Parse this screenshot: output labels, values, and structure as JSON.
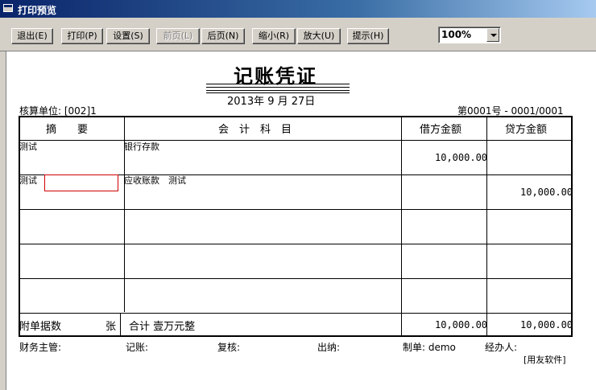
{
  "window": {
    "title": "打印预览"
  },
  "toolbar": {
    "exit": "退出(E)",
    "print": "打印(P)",
    "settings": "设置(S)",
    "prev": "前页(L)",
    "next": "后页(N)",
    "zoom_out": "缩小(R)",
    "zoom_in": "放大(U)",
    "hint": "提示(H)",
    "zoom_value": "100%"
  },
  "voucher": {
    "title": "记账凭证",
    "date": "2013年  9  月 27日",
    "unit": "核算单位: [002]1",
    "number": "第0001号 - 0001/0001",
    "headers": {
      "summary": "摘　　要",
      "account": "会　计　科　目",
      "debit": "借方金额",
      "credit": "贷方金额"
    },
    "rows": [
      {
        "summary": "测试",
        "account": "银行存款",
        "debit": "10,000.00",
        "credit": ""
      },
      {
        "summary": "测试",
        "account": "应收账款　测试",
        "debit": "",
        "credit": "10,000.00"
      }
    ],
    "footer": {
      "attach_label": "附单据数",
      "attach_unit": "张",
      "total_label": "合计 壹万元整",
      "debit_total": "10,000.00",
      "credit_total": "10,000.00"
    },
    "signatures": {
      "supervisor": "财务主管:",
      "bookkeeper": "记账:",
      "reviewer": "复核:",
      "cashier": "出纳:",
      "maker": "制单: demo",
      "handler": "经办人:"
    },
    "brand": "[用友软件]"
  }
}
